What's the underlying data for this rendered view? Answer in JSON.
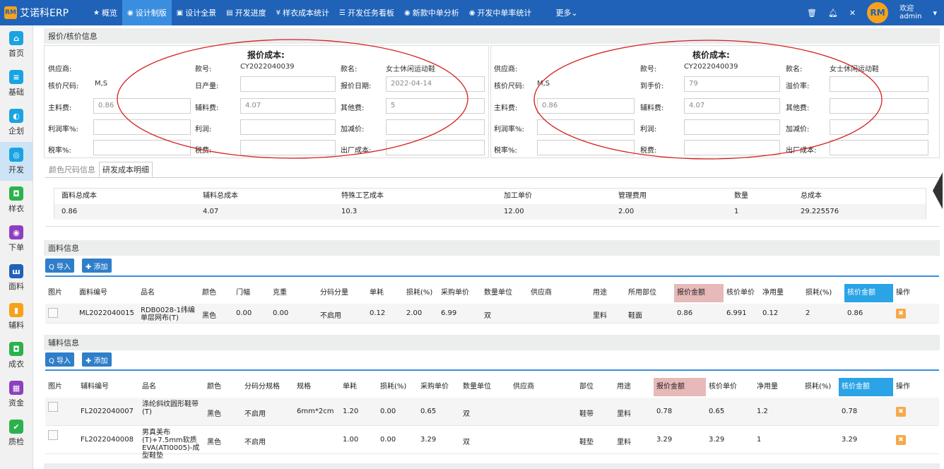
{
  "app": {
    "brand": "艾诺科ERP",
    "logo_text": "RM"
  },
  "nav": [
    {
      "icon": "★",
      "label": "概览"
    },
    {
      "icon": "◉",
      "label": "设计制版"
    },
    {
      "icon": "▣",
      "label": "设计全景"
    },
    {
      "icon": "▤",
      "label": "开发进度"
    },
    {
      "icon": "¥",
      "label": "样衣成本统计"
    },
    {
      "icon": "☰",
      "label": "开发任务看板"
    },
    {
      "icon": "◉",
      "label": "新款中单分析"
    },
    {
      "icon": "◉",
      "label": "开发中单率统计"
    },
    {
      "icon": "",
      "label": "更多⌄"
    }
  ],
  "user": {
    "welcome": "欢迎",
    "name": "admin",
    "avatar_text": "RM"
  },
  "sidebar": [
    {
      "label": "首页",
      "icon": "⌂",
      "color": "#1aa3e2"
    },
    {
      "label": "基础",
      "icon": "≡",
      "color": "#1aa3e2"
    },
    {
      "label": "企划",
      "icon": "◐",
      "color": "#1aa3e2"
    },
    {
      "label": "开发",
      "icon": "◎",
      "color": "#1aa3e2"
    },
    {
      "label": "样衣",
      "icon": "◘",
      "color": "#2bb24c"
    },
    {
      "label": "下单",
      "icon": "◉",
      "color": "#8e3fbf"
    },
    {
      "label": "面料",
      "icon": "ш",
      "color": "#1f62b8"
    },
    {
      "label": "辅料",
      "icon": "▮",
      "color": "#f6a21a"
    },
    {
      "label": "成衣",
      "icon": "◘",
      "color": "#2bb24c"
    },
    {
      "label": "资金",
      "icon": "▦",
      "color": "#8e3fbf"
    },
    {
      "label": "质检",
      "icon": "✔",
      "color": "#2bb24c"
    }
  ],
  "panel_title": "报价/核价信息",
  "quote": {
    "title": "报价成本:",
    "supplier_label": "供应商:",
    "style_no_label": "款号:",
    "style_no": "CY2022040039",
    "style_name_label": "款名:",
    "style_name": "女士休闲运动鞋",
    "size_label": "核价尺码:",
    "size": "M,S",
    "daily_output_label": "日产量:",
    "date_label": "报价日期:",
    "date": "2022-04-14",
    "main_fee_label": "主料费:",
    "main_fee": "0.86",
    "aux_fee_label": "辅料费:",
    "aux_fee": "4.07",
    "other_fee_label": "其他费:",
    "other_fee": "5",
    "profit_rate_label": "利润率%:",
    "profit_label": "利润:",
    "adjust_label": "加减价:",
    "tax_rate_label": "税率%:",
    "tax_label": "税费:",
    "factory_cost_label": "出厂成本:"
  },
  "check": {
    "title": "核价成本:",
    "supplier_label": "供应商:",
    "style_no_label": "款号:",
    "style_no": "CY2022040039",
    "style_name_label": "款名:",
    "style_name": "女士休闲运动鞋",
    "size_label": "核价尺码:",
    "size": "M,S",
    "arrival_label": "到手价:",
    "arrival": "79",
    "premium_label": "溢价率:",
    "main_fee_label": "主料费:",
    "main_fee": "0.86",
    "aux_fee_label": "辅料费:",
    "aux_fee": "4.07",
    "other_fee_label": "其他费:",
    "profit_rate_label": "利润率%:",
    "profit_label": "利润:",
    "adjust_label": "加减价:",
    "tax_rate_label": "税率%:",
    "tax_label": "税费:",
    "factory_cost_label": "出厂成本:"
  },
  "tabs": [
    "颜色尺码信息",
    "研发成本明细"
  ],
  "cost_summary": {
    "headers": [
      "面料总成本",
      "辅料总成本",
      "特殊工艺成本",
      "加工单价",
      "管理费用",
      "数量",
      "总成本"
    ],
    "values": [
      "0.86",
      "4.07",
      "10.3",
      "12.00",
      "2.00",
      "1",
      "29.225576"
    ]
  },
  "fabric": {
    "title": "面料信息",
    "import_label": "Q 导入",
    "add_label": "✚ 添加",
    "headers": [
      "图片",
      "面料编号",
      "品名",
      "颜色",
      "门幅",
      "克重",
      "分码分量",
      "单耗",
      "损耗(%)",
      "采购单价",
      "数量单位",
      "供应商",
      "用途",
      "所用部位",
      "报价金额",
      "核价单价",
      "净用量",
      "损耗(%)",
      "核价金额",
      "操作"
    ],
    "rows": [
      {
        "code": "ML2022040015",
        "name": "RDB0028-1纬编单层网布(T)",
        "color": "黑色",
        "width": "0.00",
        "weight": "0.00",
        "split": "不启用",
        "usage": "0.12",
        "loss": "2.00",
        "price": "6.99",
        "unit": "双",
        "supplier": "",
        "purpose": "里料",
        "part": "鞋面",
        "quote_amount": "0.86",
        "check_price": "6.991",
        "net_usage": "0.12",
        "check_loss": "2",
        "check_amount": "0.86",
        "del": "✖"
      }
    ]
  },
  "accessory": {
    "title": "辅料信息",
    "import_label": "Q 导入",
    "add_label": "✚ 添加",
    "headers": [
      "图片",
      "辅料编号",
      "品名",
      "颜色",
      "分码分规格",
      "规格",
      "单耗",
      "损耗(%)",
      "采购单价",
      "数量单位",
      "供应商",
      "部位",
      "用途",
      "报价金额",
      "核价单价",
      "净用量",
      "损耗(%)",
      "核价金额",
      "操作"
    ],
    "rows": [
      {
        "code": "FL2022040007",
        "name": "涤纶斜纹圆形鞋带(T)",
        "color": "黑色",
        "split": "不启用",
        "spec": "6mm*2cm",
        "usage": "1.20",
        "loss": "0.00",
        "price": "0.65",
        "unit": "双",
        "supplier": "",
        "part": "鞋带",
        "purpose": "里料",
        "quote_amount": "0.78",
        "check_price": "0.65",
        "net_usage": "1.2",
        "check_loss": "",
        "check_amount": "0.78",
        "del": "✖"
      },
      {
        "code": "FL2022040008",
        "name": "男真美布(T)+7.5mm软质EVA(ATI0005)-成型鞋垫",
        "color": "黑色",
        "split": "不启用",
        "spec": "",
        "usage": "1.00",
        "loss": "0.00",
        "price": "3.29",
        "unit": "双",
        "supplier": "",
        "part": "鞋垫",
        "purpose": "里料",
        "quote_amount": "3.29",
        "check_price": "3.29",
        "net_usage": "1",
        "check_loss": "",
        "check_amount": "3.29",
        "del": "✖"
      }
    ]
  }
}
